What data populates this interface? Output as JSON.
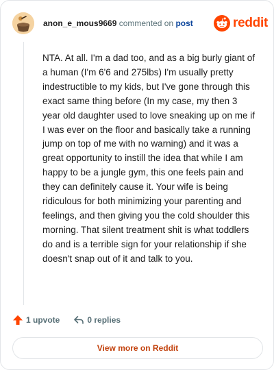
{
  "comment": {
    "author": "anon_e_mous9669",
    "action_text": "commented on",
    "target_text": "post",
    "body": "NTA. At all. I'm a dad too, and as a big burly giant of a human (I'm 6'6 and 275lbs) I'm usually pretty indestructible to my kids, but I've gone through this exact same thing before (In my case, my then 3 year old daughter used to love sneaking up on me if I was ever on the floor and basically take a running jump on top of me with no warning) and it was a great opportunity to instill the idea that while I am happy to be a jungle gym, this one feels pain and they can definitely cause it. Your wife is being ridiculous for both minimizing your parenting and feelings, and then giving you the cold shoulder this morning. That silent treatment shit is what toddlers do and is a terrible sign for your relationship if she doesn't snap out of it and talk to you."
  },
  "brand": {
    "wordmark": "reddit",
    "color": "#ff4500"
  },
  "actions": {
    "upvotes": "1 upvote",
    "replies": "0 replies"
  },
  "footer": {
    "view_more": "View more on Reddit"
  },
  "icons": {
    "avatar": "avatar",
    "logo": "reddit-alien-icon",
    "upvote": "upvote-arrow-icon",
    "reply": "reply-arrow-icon"
  },
  "colors": {
    "text": "#1c1c1c",
    "muted": "#576f76",
    "link": "#0a449b",
    "upvote": "#ff4500",
    "view_more": "#c2410c",
    "border": "#e2e5e8"
  }
}
